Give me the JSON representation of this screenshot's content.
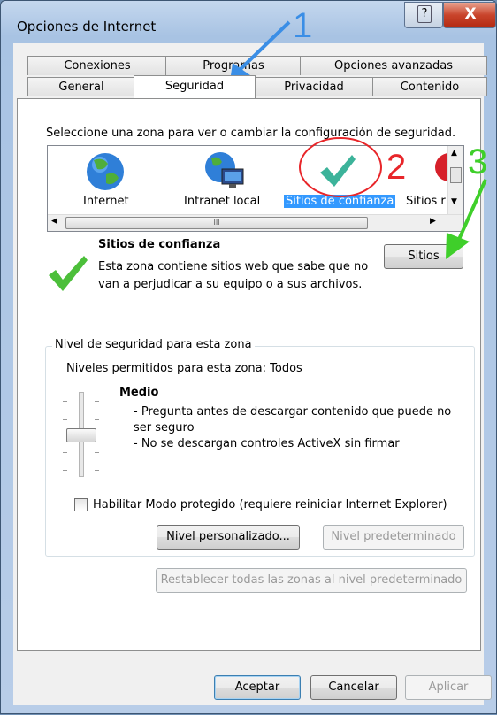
{
  "window": {
    "title": "Opciones de Internet",
    "help_symbol": "?",
    "close_symbol": "X"
  },
  "tabs_row1": [
    "Conexiones",
    "Programas",
    "Opciones avanzadas"
  ],
  "tabs_row2": [
    "General",
    "Seguridad",
    "Privacidad",
    "Contenido"
  ],
  "active_tab": "Seguridad",
  "security": {
    "instruction": "Seleccione una zona para ver o cambiar la configuración de seguridad.",
    "zones": [
      "Internet",
      "Intranet local",
      "Sitios de confianza",
      "Sitios r"
    ],
    "selected_zone": "Sitios de confianza",
    "hscroll_grip": "III",
    "zone_title": "Sitios de confianza",
    "zone_desc_1": "Esta zona contiene sitios web que sabe que no",
    "zone_desc_2": "van a perjudicar a su equipo o a sus archivos.",
    "sites_button": "Sitios",
    "group_title": "Nivel de seguridad para esta zona",
    "allowed_levels": "Niveles permitidos para esta zona: Todos",
    "level_name": "Medio",
    "level_line_1": "- Pregunta antes de descargar contenido que puede no",
    "level_line_2": "ser seguro",
    "level_line_3": "- No se descargan controles ActiveX sin firmar",
    "protected_mode_label": "Habilitar Modo protegido (requiere reiniciar Internet Explorer)",
    "protected_mode_checked": false,
    "custom_level_button": "Nivel personalizado...",
    "default_level_button": "Nivel predeterminado",
    "reset_all_button": "Restablecer todas las zonas al nivel predeterminado"
  },
  "footer": {
    "ok": "Aceptar",
    "cancel": "Cancelar",
    "apply": "Aplicar"
  },
  "annotations": {
    "n1": "1",
    "n2": "2",
    "n3": "3",
    "color1": "#3a8ee6",
    "color2": "#e8262a",
    "color3": "#3fcf2a"
  }
}
